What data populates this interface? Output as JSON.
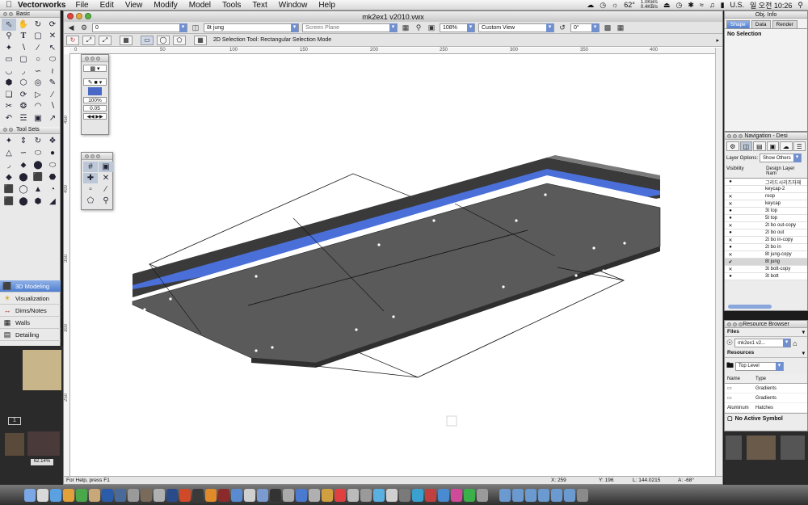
{
  "menubar": {
    "app_name": "Vectorworks",
    "menus": [
      "File",
      "Edit",
      "View",
      "Modify",
      "Model",
      "Tools",
      "Text",
      "Window",
      "Help"
    ],
    "net_up": "1.0KB/s",
    "net_down": "0.4KB/s",
    "temperature": "62°",
    "input_lang": "U.S.",
    "clock": "일 오전 10:26"
  },
  "basic_palette": {
    "title": "Basic"
  },
  "tool_sets_palette": {
    "title": "Tool Sets"
  },
  "tool_sets": [
    {
      "label": "3D Modeling",
      "active": true
    },
    {
      "label": "Visualization",
      "active": false
    },
    {
      "label": "Dims/Notes",
      "active": false
    },
    {
      "label": "Walls",
      "active": false
    },
    {
      "label": "Detailing",
      "active": false
    }
  ],
  "document": {
    "title": "mk2ex1 v2010.vwx",
    "class_combo": "0",
    "layer_combo": "8t jung",
    "plane_combo": "Screen Plane",
    "zoom": "108%",
    "view_combo": "Custom View",
    "angle_field": "0°",
    "mode_hint": "2D Selection Tool: Rectangular Selection Mode",
    "ruler_h": [
      "0",
      "50",
      "100",
      "150",
      "200",
      "250",
      "300",
      "350",
      "400"
    ],
    "ruler_v": [
      "450",
      "400",
      "350",
      "300",
      "250"
    ]
  },
  "statusbar": {
    "help": "For Help, press F1",
    "x": "X: 259",
    "y": "Y: 196",
    "l": "L: 144.0215",
    "a": "A: -68°"
  },
  "attributes_palette": {
    "line_weight": "100%",
    "thickness": "0.05"
  },
  "obj_info": {
    "title": "Obj. Info",
    "tabs": [
      "Shape",
      "Data",
      "Render"
    ],
    "selection": "No Selection"
  },
  "navigation": {
    "title": "Navigation - Desi",
    "layer_options_label": "Layer Options:",
    "layer_options_value": "Show Others",
    "col_visibility": "Visibility",
    "col_name": "Design Layer Nam",
    "layers": [
      {
        "name": "그리드시리즈자재",
        "vis": "●",
        "current": false
      },
      {
        "name": "keycap-2",
        "vis": "·",
        "current": false
      },
      {
        "name": "roop",
        "vis": "✕",
        "current": false
      },
      {
        "name": "keycap",
        "vis": "✕",
        "current": false
      },
      {
        "name": "3t top",
        "vis": "●",
        "current": false
      },
      {
        "name": "5t top",
        "vis": "●",
        "current": false
      },
      {
        "name": "2t bo out-copy",
        "vis": "✕",
        "current": false
      },
      {
        "name": "2t bo out",
        "vis": "●",
        "current": false
      },
      {
        "name": "2t bo in-copy",
        "vis": "✕",
        "current": false
      },
      {
        "name": "2t bo in",
        "vis": "●",
        "current": false
      },
      {
        "name": "8t jung-copy",
        "vis": "✕",
        "current": false
      },
      {
        "name": "8t jung",
        "vis": "✔",
        "current": true
      },
      {
        "name": "3t bott-copy",
        "vis": "✕",
        "current": false
      },
      {
        "name": "3t bott",
        "vis": "●",
        "current": false
      }
    ]
  },
  "resource_browser": {
    "title": "Resource Browser",
    "files_label": "Files",
    "file_value": "mk2ex1 v2...",
    "resources_label": "Resources",
    "level_value": "Top Level",
    "col_name": "Name",
    "col_type": "Type",
    "rows": [
      {
        "name": "",
        "type": "Gradients"
      },
      {
        "name": "",
        "type": "Gradients"
      },
      {
        "name": "Aluminum",
        "type": "Hatches"
      }
    ],
    "symbol_status": "No Active Symbol"
  },
  "left_bg": {
    "zoom_label": "62.14%",
    "page_num": "1"
  },
  "colors": {
    "accent": "#4f7fd0",
    "plate": "#5a5a5a",
    "stripe": "#4a6fd8"
  }
}
